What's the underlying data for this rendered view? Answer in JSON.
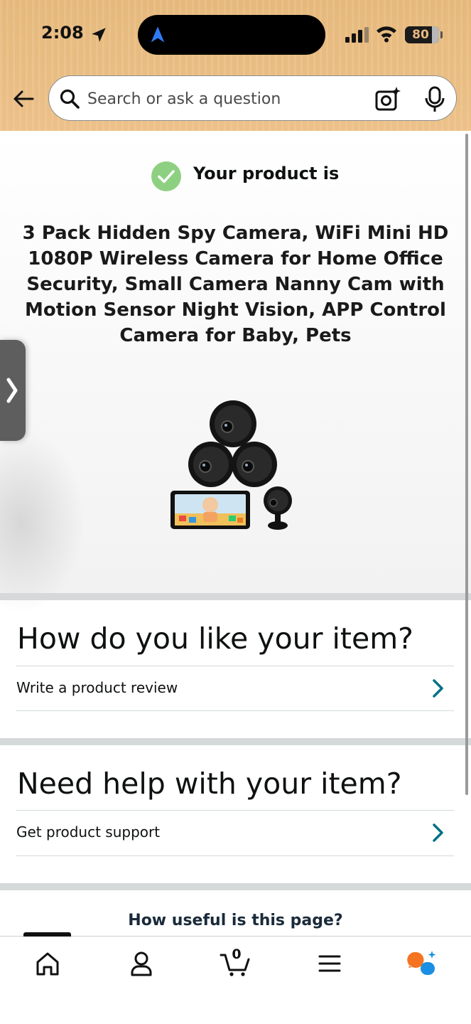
{
  "status_bar": {
    "time": "2:08",
    "battery_level": "80",
    "battery_fraction": 0.8
  },
  "search": {
    "placeholder": "Search or ask a question"
  },
  "icons": {
    "back": "back-arrow-icon",
    "search": "search-icon",
    "camera": "camera-sparkle-icon",
    "mic": "microphone-icon",
    "check": "check-circle-icon",
    "chevron": "chevron-right-icon",
    "home": "home-icon",
    "account": "account-icon",
    "cart": "cart-icon",
    "menu": "menu-icon",
    "assistant": "assistant-icon"
  },
  "colors": {
    "header_bg": "#e9bd82",
    "accent_teal": "#007185",
    "check_green": "#8ed081",
    "assistant_orange": "#f47421",
    "assistant_blue": "#1a8fe3"
  },
  "status": {
    "message": "Your product is"
  },
  "product": {
    "title": "3 Pack Hidden Spy Camera, WiFi Mini HD 1080P Wireless Camera for Home Office Security, Small Camera Nanny Cam with Motion Sensor Night Vision, APP Control Camera for Baby, Pets"
  },
  "sections": {
    "like": {
      "heading": "How do you like your item?",
      "action": "Write a product review"
    },
    "help": {
      "heading": "Need help with your item?",
      "action": "Get product support"
    }
  },
  "footer": {
    "useful_prompt": "How useful is this page?"
  },
  "bottom_nav": {
    "cart_count": "0"
  }
}
